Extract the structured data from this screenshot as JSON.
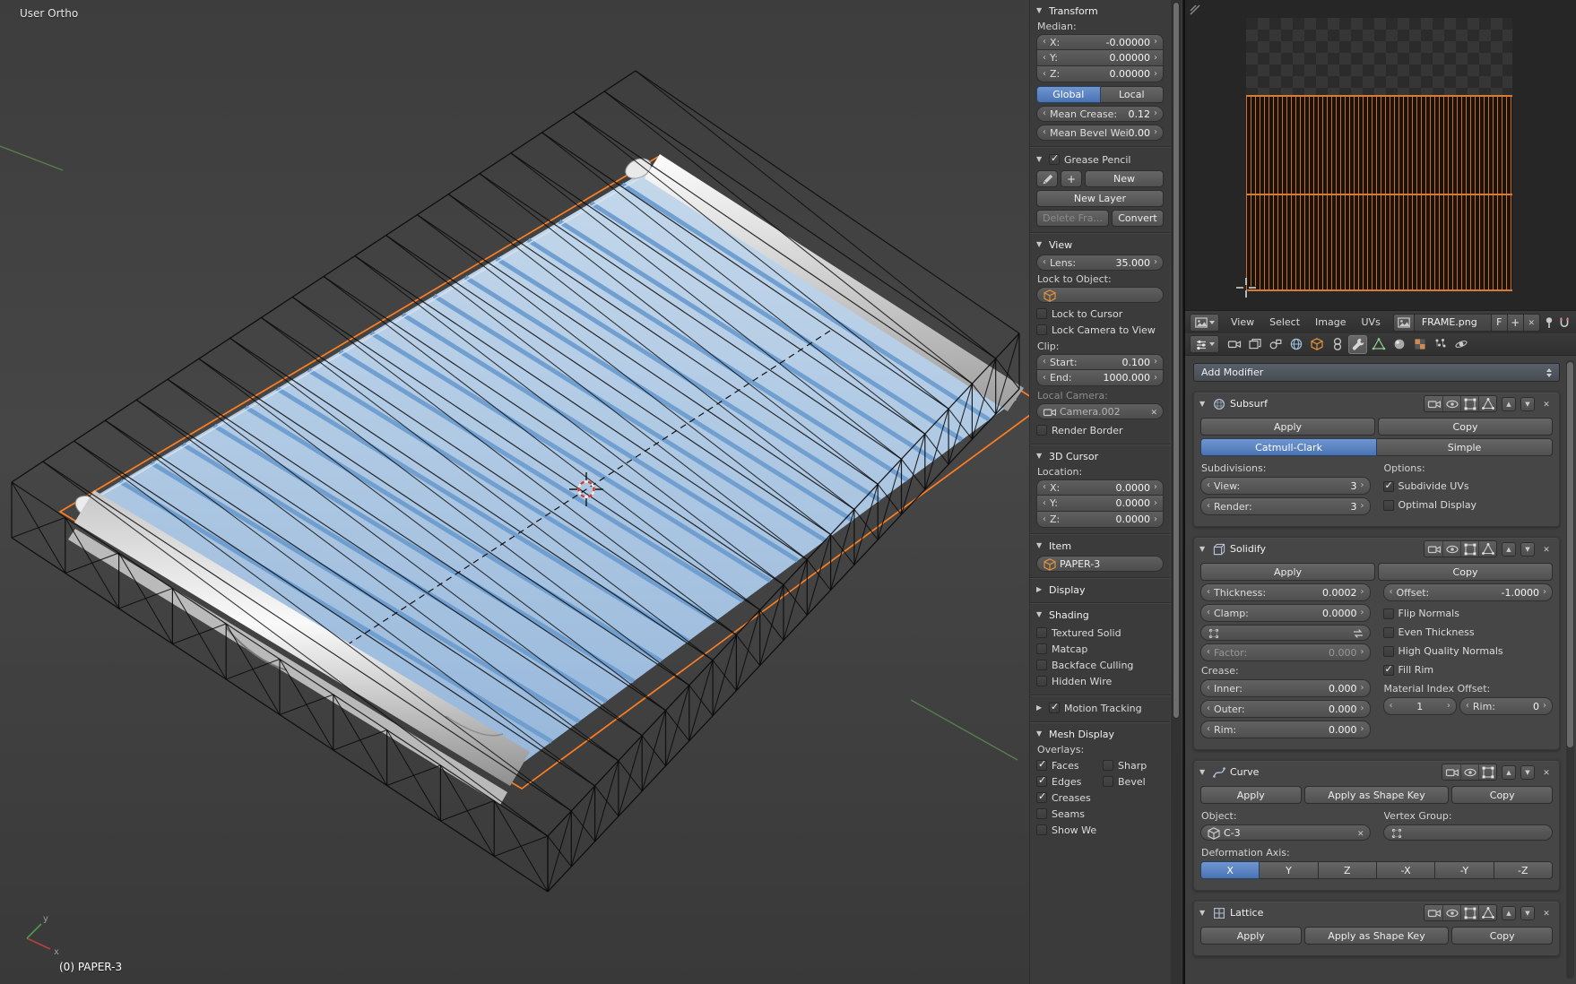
{
  "colors": {
    "accent": "#5680c2",
    "selection_orange": "#ff7f20",
    "paper_blue": "#aac6e3",
    "uv_orange": "#c4702c"
  },
  "viewport": {
    "view_label": "User Ortho",
    "status_label": "(0) PAPER-3",
    "axis_x": "x",
    "axis_y": "y"
  },
  "n_panel": {
    "transform": {
      "title": "Transform",
      "median_label": "Median:",
      "x": {
        "label": "X:",
        "value": "-0.00000"
      },
      "y": {
        "label": "Y:",
        "value": "0.00000"
      },
      "z": {
        "label": "Z:",
        "value": "0.00000"
      },
      "global_label": "Global",
      "local_label": "Local",
      "global_active": true,
      "mean_crease": {
        "label": "Mean Crease:",
        "value": "0.12"
      },
      "mean_bevel": {
        "label": "Mean Bevel Weig:",
        "value": "0.00"
      }
    },
    "grease_pencil": {
      "title": "Grease Pencil",
      "enabled": true,
      "new_label": "New",
      "new_layer_label": "New Layer",
      "delete_frame_label": "Delete Fra...",
      "convert_label": "Convert"
    },
    "view": {
      "title": "View",
      "lens": {
        "label": "Lens:",
        "value": "35.000"
      },
      "lock_to_object_label": "Lock to Object:",
      "lock_to_cursor": {
        "label": "Lock to Cursor",
        "checked": false
      },
      "lock_camera": {
        "label": "Lock Camera to View",
        "checked": false
      },
      "clip_label": "Clip:",
      "clip_start": {
        "label": "Start:",
        "value": "0.100"
      },
      "clip_end": {
        "label": "End:",
        "value": "1000.000"
      },
      "local_camera_label": "Local Camera:",
      "camera_name": "Camera.002",
      "render_border": {
        "label": "Render Border",
        "checked": false
      }
    },
    "cursor_3d": {
      "title": "3D Cursor",
      "location_label": "Location:",
      "x": {
        "label": "X:",
        "value": "0.0000"
      },
      "y": {
        "label": "Y:",
        "value": "0.0000"
      },
      "z": {
        "label": "Z:",
        "value": "0.0000"
      }
    },
    "item": {
      "title": "Item",
      "object_name": "PAPER-3"
    },
    "display": {
      "title": "Display"
    },
    "shading": {
      "title": "Shading",
      "textured_solid": {
        "label": "Textured Solid",
        "checked": false
      },
      "matcap": {
        "label": "Matcap",
        "checked": false
      },
      "backface": {
        "label": "Backface Culling",
        "checked": false
      },
      "hidden_wire": {
        "label": "Hidden Wire",
        "checked": false
      }
    },
    "motion_tracking": {
      "title": "Motion Tracking",
      "enabled": true
    },
    "mesh_display": {
      "title": "Mesh Display",
      "overlays_label": "Overlays:",
      "faces": {
        "label": "Faces",
        "checked": true
      },
      "sharp": {
        "label": "Sharp",
        "checked": false
      },
      "edges": {
        "label": "Edges",
        "checked": true
      },
      "bevel": {
        "label": "Bevel",
        "checked": false
      },
      "creases": {
        "label": "Creases",
        "checked": true
      },
      "seams": {
        "label": "Seams",
        "checked": false
      },
      "show_weights": {
        "label": "Show Weights",
        "checked": false
      }
    }
  },
  "uv_editor": {
    "menu_view": "View",
    "menu_select": "Select",
    "menu_image": "Image",
    "menu_uvs": "UVs",
    "image_name": "FRAME.png",
    "fake_user_label": "F"
  },
  "properties": {
    "add_modifier_label": "Add Modifier",
    "tab_icons": [
      "render",
      "render-layers",
      "scene",
      "world",
      "object",
      "constraints",
      "modifiers",
      "object-data",
      "material",
      "texture",
      "particles",
      "physics"
    ],
    "active_tab": "modifiers",
    "subsurf": {
      "name": "Subsurf",
      "apply_label": "Apply",
      "copy_label": "Copy",
      "catmull_label": "Catmull-Clark",
      "catmull_active": true,
      "simple_label": "Simple",
      "subdivisions_label": "Subdivisions:",
      "options_label": "Options:",
      "view": {
        "label": "View:",
        "value": "3"
      },
      "render": {
        "label": "Render:",
        "value": "3"
      },
      "subdivide_uvs": {
        "label": "Subdivide UVs",
        "checked": true
      },
      "optimal_display": {
        "label": "Optimal Display",
        "checked": false
      }
    },
    "solidify": {
      "name": "Solidify",
      "apply_label": "Apply",
      "copy_label": "Copy",
      "thickness": {
        "label": "Thickness:",
        "value": "0.0002"
      },
      "clamp": {
        "label": "Clamp:",
        "value": "0.0000"
      },
      "factor": {
        "label": "Factor:",
        "value": "0.000"
      },
      "offset": {
        "label": "Offset:",
        "value": "-1.0000"
      },
      "flip_normals": {
        "label": "Flip Normals",
        "checked": false
      },
      "even_thickness": {
        "label": "Even Thickness",
        "checked": false
      },
      "high_quality": {
        "label": "High Quality Normals",
        "checked": false
      },
      "fill_rim": {
        "label": "Fill Rim",
        "checked": true
      },
      "crease_label": "Crease:",
      "material_index_label": "Material Index Offset:",
      "inner": {
        "label": "Inner:",
        "value": "0.000"
      },
      "outer": {
        "label": "Outer:",
        "value": "0.000"
      },
      "rim": {
        "label": "Rim:",
        "value": "0.000"
      },
      "mat_offset_value": "1",
      "mat_rim": {
        "label": "Rim:",
        "value": "0"
      }
    },
    "curve": {
      "name": "Curve",
      "apply_label": "Apply",
      "apply_shape_label": "Apply as Shape Key",
      "copy_label": "Copy",
      "object_label": "Object:",
      "vertex_group_label": "Vertex Group:",
      "object_value": "C-3",
      "deformation_axis_label": "Deformation Axis:",
      "axes": [
        {
          "label": "X",
          "active": true
        },
        {
          "label": "Y",
          "active": false
        },
        {
          "label": "Z",
          "active": false
        },
        {
          "label": "-X",
          "active": false
        },
        {
          "label": "-Y",
          "active": false
        },
        {
          "label": "-Z",
          "active": false
        }
      ]
    },
    "lattice": {
      "name": "Lattice",
      "apply_label": "Apply",
      "apply_shape_label": "Apply as Shape Key",
      "copy_label": "Copy"
    }
  }
}
